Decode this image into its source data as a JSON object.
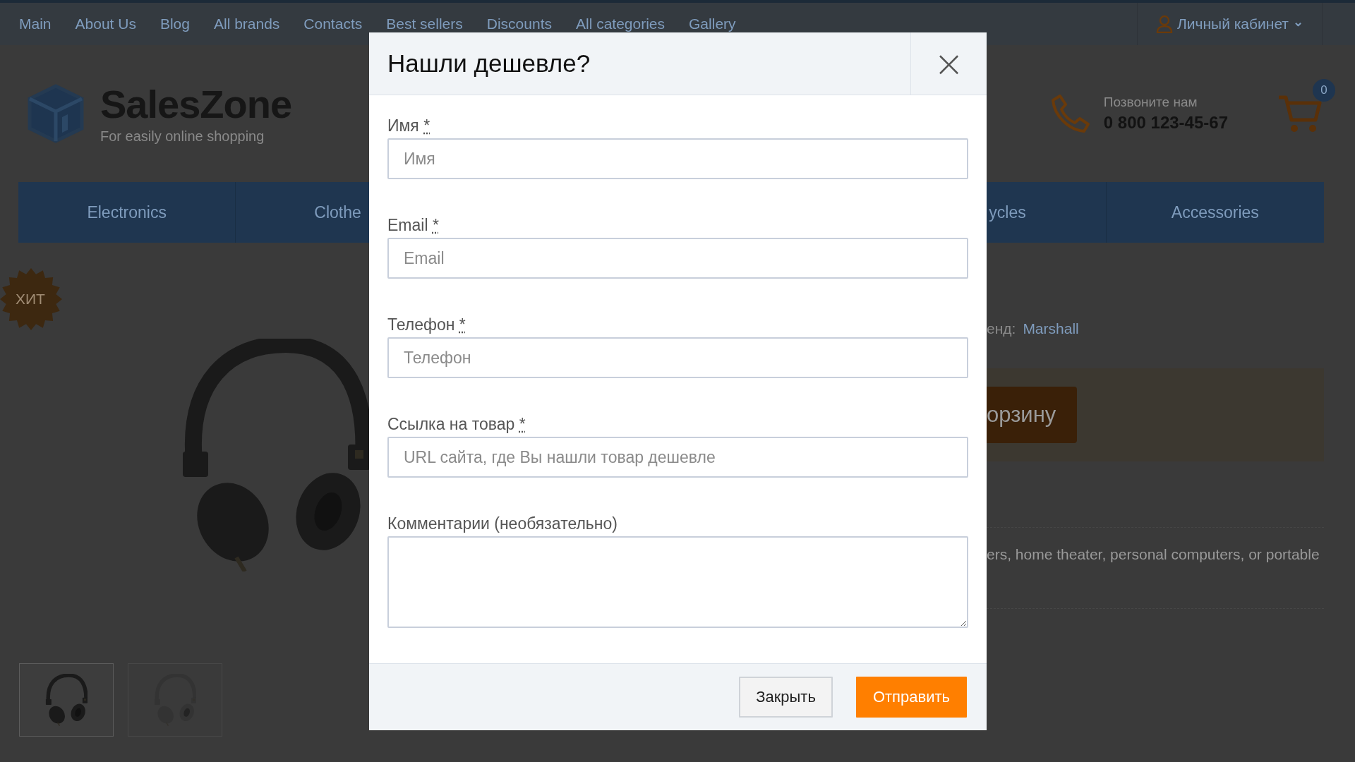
{
  "top_nav": {
    "items": [
      {
        "label": "Main"
      },
      {
        "label": "About Us"
      },
      {
        "label": "Blog"
      },
      {
        "label": "All brands"
      },
      {
        "label": "Contacts"
      },
      {
        "label": "Best sellers"
      },
      {
        "label": "Discounts"
      },
      {
        "label": "All categories"
      },
      {
        "label": "Gallery"
      }
    ],
    "account": {
      "label": "Личный кабинет",
      "caret": "⌄"
    }
  },
  "header": {
    "logo": {
      "name": "SalesZone",
      "tagline": "For easily online shopping"
    },
    "phone": {
      "caption": "Позвоните нам",
      "number": "0 800 123-45-67"
    },
    "cart": {
      "count": "0"
    }
  },
  "categories": [
    {
      "label": "Electronics"
    },
    {
      "label": "Clothe"
    },
    {
      "label": "ycles"
    },
    {
      "label": "Accessories"
    }
  ],
  "product": {
    "badge": "ХИТ",
    "image": {
      "kind": "picture"
    },
    "thumbnails": [
      {
        "kind": "picture",
        "selected": true
      },
      {
        "kind": "picture",
        "selected": false
      }
    ],
    "brand_label": "енд:",
    "brand": "Marshall",
    "buy_button": "орзину",
    "description": "ers, home theater, personal computers, or portable"
  },
  "modal": {
    "title": "Нашли дешевле?",
    "close": "×",
    "fields": [
      {
        "kind": "input",
        "label": "Имя",
        "required_mark": "*",
        "placeholder": "Имя"
      },
      {
        "kind": "input",
        "label": "Email",
        "required_mark": "*",
        "placeholder": "Email"
      },
      {
        "kind": "input",
        "label": "Телефон",
        "required_mark": "*",
        "placeholder": "Телефон"
      },
      {
        "kind": "input",
        "label": "Ссылка на товар",
        "required_mark": "*",
        "placeholder": "URL сайта, где Вы нашли товар дешевле"
      },
      {
        "kind": "textarea",
        "label": "Комментарии (необязательно)"
      }
    ],
    "buttons": [
      {
        "kind": "secondary",
        "label": "Закрыть"
      },
      {
        "kind": "primary",
        "label": "Отправить"
      }
    ]
  }
}
